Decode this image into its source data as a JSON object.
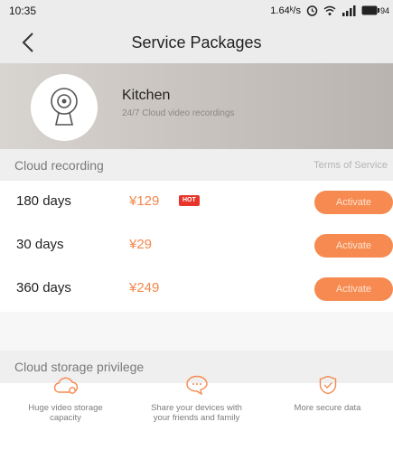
{
  "status_bar": {
    "time": "10:35",
    "speed": "1.64ᵏ/s",
    "battery": "94"
  },
  "nav": {
    "title": "Service Packages"
  },
  "device": {
    "name": "Kitchen",
    "description": "24/7 Cloud video recordings"
  },
  "cloud_recording": {
    "title": "Cloud recording",
    "terms_link": "Terms of Service",
    "plans": [
      {
        "days": "180 days",
        "price": "¥129",
        "badge": "HOT",
        "action": "Activate"
      },
      {
        "days": "30 days",
        "price": "¥29",
        "badge": "",
        "action": "Activate"
      },
      {
        "days": "360 days",
        "price": "¥249",
        "badge": "",
        "action": "Activate"
      }
    ]
  },
  "privilege": {
    "title": "Cloud storage privilege",
    "items": [
      {
        "icon": "cloud-icon",
        "label": "Huge video storage capacity"
      },
      {
        "icon": "chat-bubble-icon",
        "label": "Share your devices with your friends and family"
      },
      {
        "icon": "shield-check-icon",
        "label": "More secure data"
      }
    ]
  },
  "colors": {
    "accent": "#f68a50",
    "hot": "#e8352b"
  }
}
